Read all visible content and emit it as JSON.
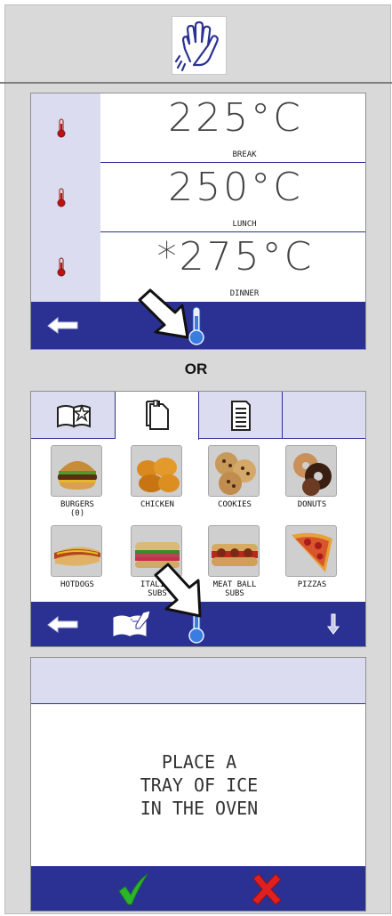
{
  "header": {
    "icon": "hand-clean-icon"
  },
  "screen1": {
    "rows": [
      {
        "value": "225°C",
        "label": "BREAK"
      },
      {
        "value": "250°C",
        "label": "LUNCH"
      },
      {
        "value": "*275°C",
        "label": "DINNER"
      }
    ],
    "icons": [
      "thermometer-icon",
      "back-arrow-icon",
      "thermometer-button-icon"
    ]
  },
  "separator": "OR",
  "screen2": {
    "tabs": [
      "recipe-book-star-icon",
      "clipboard-icon",
      "list-page-icon"
    ],
    "items": [
      {
        "label": "BURGERS\n(0)"
      },
      {
        "label": "CHICKEN"
      },
      {
        "label": "COOKIES"
      },
      {
        "label": "DONUTS"
      },
      {
        "label": "HOTDOGS"
      },
      {
        "label": "ITALIAN\nSUBS"
      },
      {
        "label": "MEAT BALL\nSUBS"
      },
      {
        "label": "PIZZAS"
      }
    ]
  },
  "screen3": {
    "message": "PLACE A\nTRAY OF ICE\nIN THE OVEN"
  },
  "colors": {
    "bar": "#2b3192",
    "panel": "#dcdcf0",
    "ok": "#2bb52b",
    "cancel": "#e02020"
  }
}
